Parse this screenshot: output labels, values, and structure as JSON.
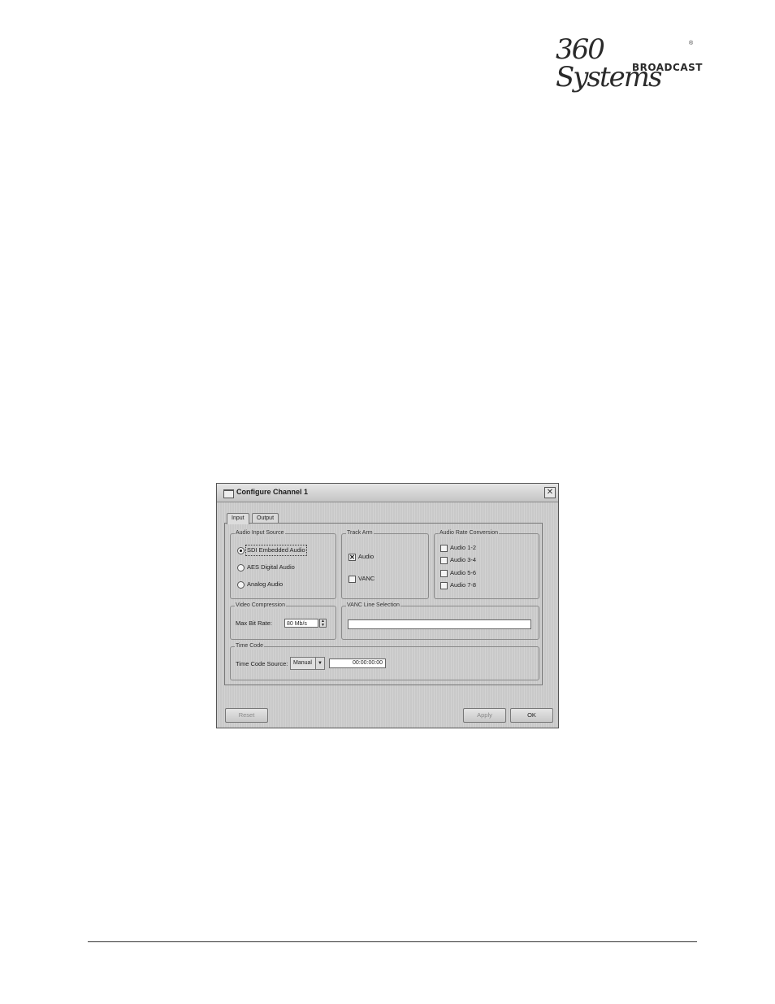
{
  "logo": {
    "script_text": "360 Systems",
    "sub_text": "BROADCAST",
    "reg_mark": "®"
  },
  "dialog": {
    "title": "Configure Channel 1",
    "close_glyph": "✕",
    "tabs": [
      {
        "label": "Input",
        "active": true
      },
      {
        "label": "Output",
        "active": false
      }
    ],
    "audio_input_source": {
      "label": "Audio Input Source",
      "options": [
        {
          "label": "SDI Embedded Audio",
          "selected": true
        },
        {
          "label": "AES Digital Audio",
          "selected": false
        },
        {
          "label": "Analog Audio",
          "selected": false
        }
      ]
    },
    "track_arm": {
      "label": "Track Arm",
      "items": [
        {
          "label": "Audio",
          "checked": true
        },
        {
          "label": "VANC",
          "checked": false
        }
      ]
    },
    "audio_rate_conversion": {
      "label": "Audio Rate Conversion",
      "items": [
        {
          "label": "Audio 1-2",
          "checked": false
        },
        {
          "label": "Audio 3-4",
          "checked": false
        },
        {
          "label": "Audio 5-6",
          "checked": false
        },
        {
          "label": "Audio 7-8",
          "checked": false
        }
      ]
    },
    "video_compression": {
      "label": "Video Compression",
      "max_bit_rate_label": "Max Bit Rate:",
      "max_bit_rate_value": "80 Mb/s"
    },
    "vanc_line_selection": {
      "label": "VANC Line Selection",
      "value": ""
    },
    "time_code": {
      "label": "Time Code",
      "source_label": "Time Code Source:",
      "source_value": "Manual",
      "value": "00:00:00:00"
    },
    "buttons": {
      "reset": "Reset",
      "apply": "Apply",
      "ok": "OK"
    }
  }
}
